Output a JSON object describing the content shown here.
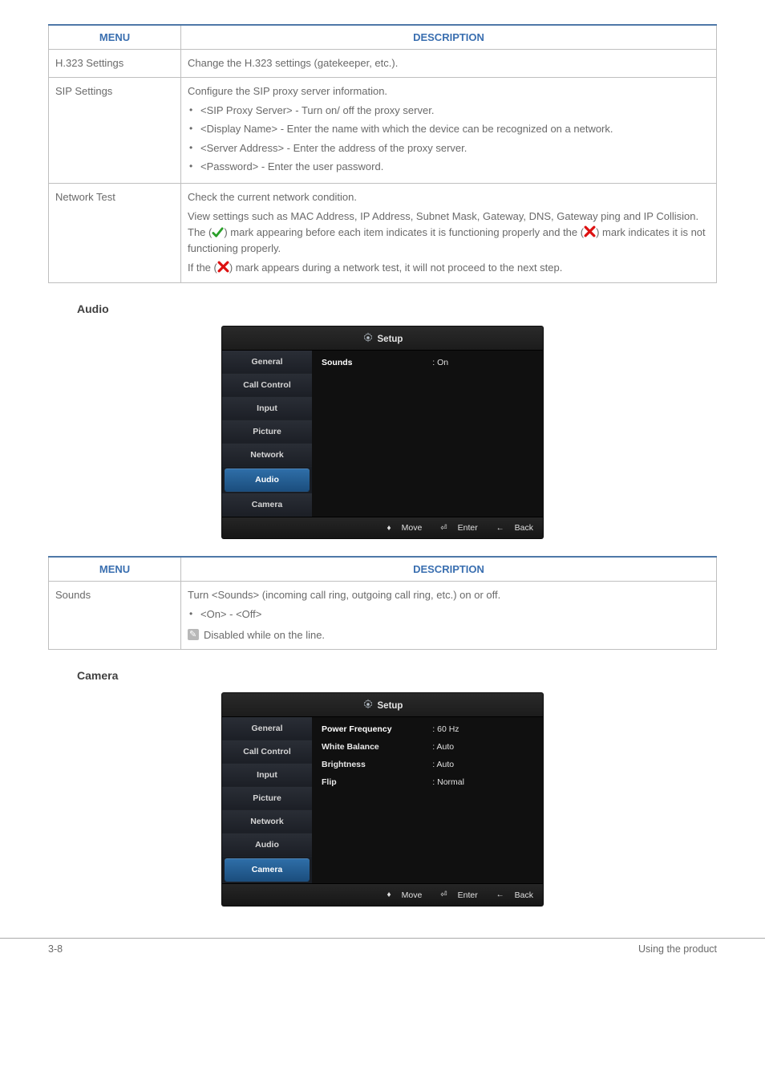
{
  "table1": {
    "headers": {
      "menu": "MENU",
      "description": "DESCRIPTION"
    },
    "rows": [
      {
        "menu": "H.323 Settings",
        "desc_intro": "Change the H.323 settings (gatekeeper, etc.)."
      },
      {
        "menu": "SIP Settings",
        "desc_intro": "Configure the SIP proxy server information.",
        "bullets": [
          "<SIP Proxy Server> - Turn on/ off the proxy server.",
          "<Display Name> - Enter the name with which the device can be recognized on a network.",
          "<Server Address> - Enter the address of the proxy server.",
          "<Password> - Enter the user password."
        ]
      },
      {
        "menu": "Network Test",
        "p1": "Check the current network condition.",
        "p2a": "View settings such as MAC Address, IP Address, Subnet Mask, Gateway, DNS, Gateway ping and IP Collision. The (",
        "p2b": ") mark appearing before each item indicates it is functioning properly and the (",
        "p2c": ") mark indicates it is not functioning properly.",
        "p3a": "If the (",
        "p3b": ") mark appears during a network test, it will not proceed to the next step."
      }
    ]
  },
  "section_audio": "Audio",
  "osd_audio": {
    "title": "Setup",
    "nav": [
      "General",
      "Call Control",
      "Input",
      "Picture",
      "Network",
      "Audio",
      "Camera"
    ],
    "active_index": 5,
    "items": [
      {
        "label": "Sounds",
        "value": ": On"
      }
    ],
    "footer": {
      "move": "Move",
      "enter": "Enter",
      "back": "Back"
    }
  },
  "table2": {
    "headers": {
      "menu": "MENU",
      "description": "DESCRIPTION"
    },
    "row": {
      "menu": "Sounds",
      "desc_intro": "Turn <Sounds> (incoming call ring, outgoing call ring, etc.) on or off.",
      "bullet": "<On> - <Off>",
      "note": "Disabled while on the line."
    }
  },
  "section_camera": "Camera",
  "osd_camera": {
    "title": "Setup",
    "nav": [
      "General",
      "Call Control",
      "Input",
      "Picture",
      "Network",
      "Audio",
      "Camera"
    ],
    "active_index": 6,
    "items": [
      {
        "label": "Power Frequency",
        "value": ": 60 Hz"
      },
      {
        "label": "White Balance",
        "value": ": Auto"
      },
      {
        "label": "Brightness",
        "value": ": Auto"
      },
      {
        "label": "Flip",
        "value": ": Normal"
      }
    ],
    "footer": {
      "move": "Move",
      "enter": "Enter",
      "back": "Back"
    }
  },
  "footer": {
    "left": "3-8",
    "right": "Using the product"
  }
}
